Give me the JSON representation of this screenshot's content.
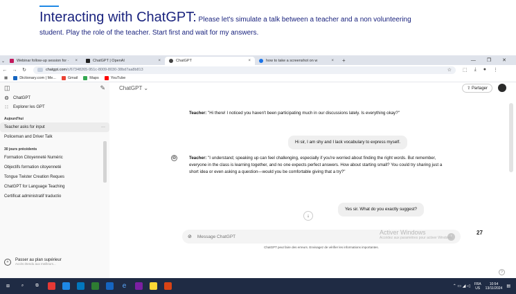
{
  "slide": {
    "title_big": "Interacting with ChatGPT:",
    "title_small": " Please let's simulate a talk between a teacher and a non volunteering",
    "title_line2": "student. Play the role of the teacher. Start first and wait for my answers."
  },
  "browser": {
    "tabs": [
      {
        "label": "Webinar follow-up session for ·",
        "color": "#c2185b",
        "active": false
      },
      {
        "label": "ChatGPT | OpenAI",
        "color": "#222222",
        "active": false
      },
      {
        "label": "ChatGPT",
        "color": "#444444",
        "active": true
      },
      {
        "label": "how to take a screenshot on w",
        "color": "#1a73e8",
        "active": false
      }
    ],
    "new_tab": "+",
    "url_host": "chatgpt.com",
    "url_path": "/c/67348265-951c-8009-8030-38bd7aa8b813",
    "bookmarks": [
      {
        "label": "Dictionary.com | Me...",
        "color": "#1565c0"
      },
      {
        "label": "Gmail",
        "color": "#ea4335"
      },
      {
        "label": "Maps",
        "color": "#34a853"
      },
      {
        "label": "YouTube",
        "color": "#ff0000"
      }
    ]
  },
  "sidebar": {
    "nav": [
      {
        "label": "ChatGPT",
        "icon": "chatgpt-logo-icon"
      },
      {
        "label": "Explorer les GPT",
        "icon": "grid-icon"
      }
    ],
    "section_today": "Aujourd'hui",
    "today_items": [
      "Teacher asks for input",
      "Policeman and Driver Talk"
    ],
    "section_30": "30 jours précédents",
    "past_items": [
      "Formation Citoyenneté Numéric",
      "Objectifs formation citoyenneté",
      "Tongue Twister Creation Reques",
      "ChatGPT for Language Teaching",
      "Certificat administratif traductio"
    ],
    "upgrade_title": "Passer au plan supérieur",
    "upgrade_sub": "Accès étendu aux meilleurs..."
  },
  "main": {
    "model": "ChatGPT ⌄",
    "share": "⇪ Partager",
    "msg1_label": "Teacher:",
    "msg1_text": " \"Hi there! I noticed you haven't been participating much in our discussions lately. Is everything okay?\"",
    "user1": "Hi sir, I am shy and I lack vocabulary to express myself.",
    "msg2_label": "Teacher:",
    "msg2_text": " \"I understand; speaking up can feel challenging, especially if you're worried about finding the right words. But remember, everyone in the class is learning together, and no one expects perfect answers. How about starting small? You could try sharing just a short idea or even asking a question—would you be comfortable giving that a try?\"",
    "user2": "Yes sir. What do you exactly suggest?",
    "composer_placeholder": "Message ChatGPT",
    "disclaimer": "ChatGPT peut faire des erreurs. Envisagez de vérifier les informations importantes.",
    "watermark1": "Activer Windows",
    "watermark2": "Accédez aux paramètres pour activer Windows.",
    "page_number": "27"
  },
  "taskbar": {
    "lang1": "FRA",
    "lang2": "US",
    "time": "10:54",
    "date": "13/11/2024"
  }
}
